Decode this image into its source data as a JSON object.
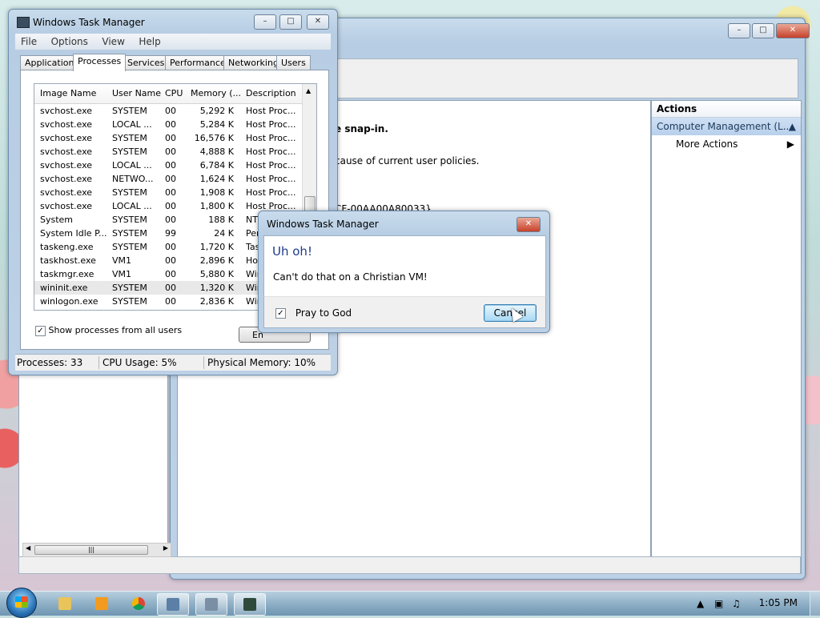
{
  "taskmanager": {
    "title": "Windows Task Manager",
    "menu": [
      "File",
      "Options",
      "View",
      "Help"
    ],
    "tabs": [
      "Applications",
      "Processes",
      "Services",
      "Performance",
      "Networking",
      "Users"
    ],
    "active_tab": "Processes",
    "columns": [
      "Image Name",
      "User Name",
      "CPU",
      "Memory (...",
      "Description"
    ],
    "rows": [
      [
        "svchost.exe",
        "SYSTEM",
        "00",
        "5,292 K",
        "Host Proc..."
      ],
      [
        "svchost.exe",
        "LOCAL ...",
        "00",
        "5,284 K",
        "Host Proc..."
      ],
      [
        "svchost.exe",
        "SYSTEM",
        "00",
        "16,576 K",
        "Host Proc..."
      ],
      [
        "svchost.exe",
        "SYSTEM",
        "00",
        "4,888 K",
        "Host Proc..."
      ],
      [
        "svchost.exe",
        "LOCAL ...",
        "00",
        "6,784 K",
        "Host Proc..."
      ],
      [
        "svchost.exe",
        "NETWO...",
        "00",
        "1,624 K",
        "Host Proc..."
      ],
      [
        "svchost.exe",
        "SYSTEM",
        "00",
        "1,908 K",
        "Host Proc..."
      ],
      [
        "svchost.exe",
        "LOCAL ...",
        "00",
        "1,800 K",
        "Host Proc..."
      ],
      [
        "System",
        "SYSTEM",
        "00",
        "188 K",
        "NT"
      ],
      [
        "System Idle P...",
        "SYSTEM",
        "99",
        "24 K",
        "Per"
      ],
      [
        "taskeng.exe",
        "SYSTEM",
        "00",
        "1,720 K",
        "Tas"
      ],
      [
        "taskhost.exe",
        "VM1",
        "00",
        "2,896 K",
        "Hos"
      ],
      [
        "taskmgr.exe",
        "VM1",
        "00",
        "5,880 K",
        "Win"
      ],
      [
        "wininit.exe",
        "SYSTEM",
        "00",
        "1,320 K",
        "Win"
      ],
      [
        "winlogon.exe",
        "SYSTEM",
        "00",
        "2,836 K",
        "Win"
      ]
    ],
    "selected_row": "wininit.exe",
    "show_all_label": "Show processes from all users",
    "end_button": "En",
    "status": {
      "processes": "Processes: 33",
      "cpu": "CPU Usage: 5%",
      "memory": "Physical Memory: 10%"
    }
  },
  "dialog": {
    "title": "Windows Task Manager",
    "heading": "Uh oh!",
    "message": "Can't do that on a Christian VM!",
    "checkbox_label": "Pray to God",
    "checkbox_checked": true,
    "cancel_label": "Cancel"
  },
  "computer_management": {
    "center_text": [
      "e snap-in.",
      "cause of current user policies.",
      "CF-00AA00A80033}"
    ],
    "actions_header": "Actions",
    "actions_section": "Computer Management (L...",
    "actions_item": "More Actions"
  },
  "taskbar": {
    "clock": "1:05 PM",
    "buttons": [
      "Explorer",
      "Media Player",
      "Chrome",
      "Remote Desktop",
      "Computer Management",
      "Task Manager"
    ]
  },
  "icons": {
    "close": "close-icon",
    "minimize": "minimize-icon",
    "maximize": "maximize-icon",
    "start": "windows-logo-icon",
    "cursor": "mouse-pointer-icon"
  },
  "colors": {
    "dialog_heading": "#1e3a8a",
    "close_button": "#c7412a",
    "cancel_button": "#a7d9f5",
    "taskbar": "#8fb0c7"
  }
}
